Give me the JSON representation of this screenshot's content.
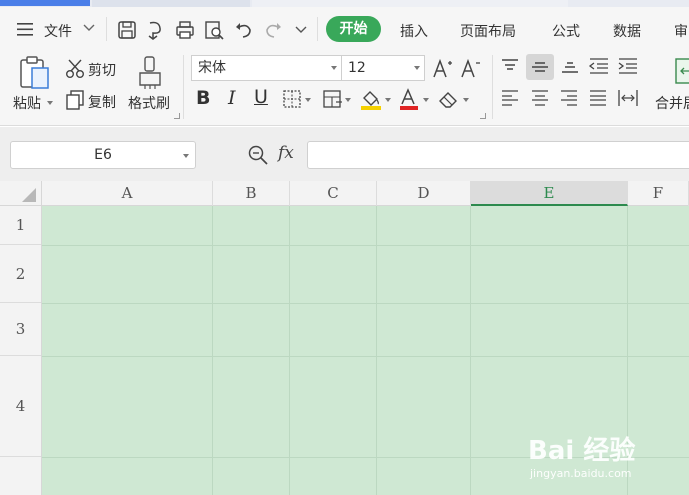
{
  "menubar": {
    "file_label": "文件",
    "tabs": [
      "开始",
      "插入",
      "页面布局",
      "公式",
      "数据",
      "审"
    ]
  },
  "ribbon": {
    "paste_label": "粘贴",
    "cut_label": "剪切",
    "copy_label": "复制",
    "format_painter_label": "格式刷",
    "font_name": "宋体",
    "font_size": "12",
    "merge_label": "合并居"
  },
  "formula_bar": {
    "cell_ref": "E6",
    "fx_label": "fx",
    "formula_value": ""
  },
  "grid": {
    "columns": [
      "A",
      "B",
      "C",
      "D",
      "E",
      "F"
    ],
    "selected_column": "E",
    "rows": [
      "1",
      "2",
      "3",
      "4"
    ]
  },
  "watermark": {
    "logo_text": "Bai 经验",
    "url": "jingyan.baidu.com"
  },
  "colors": {
    "accent_green": "#39a85a",
    "selection_fill": "#cfe8d3",
    "selected_header_text": "#2d8a4e"
  }
}
